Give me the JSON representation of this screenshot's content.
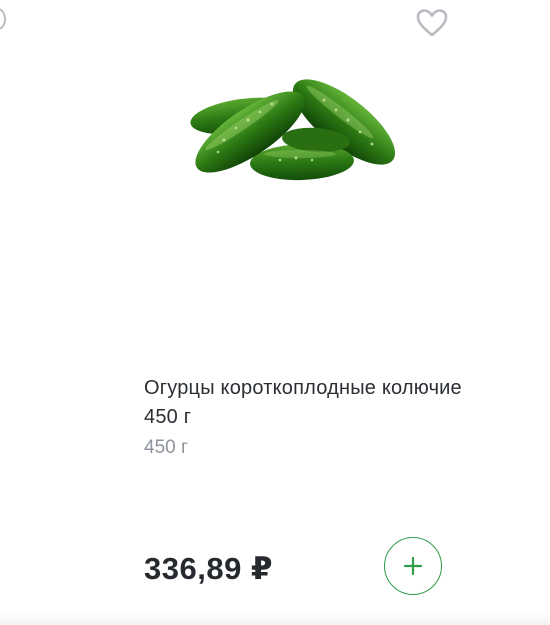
{
  "product": {
    "title": "Огурцы короткоплодные колючие 450 г",
    "weight": "450 г",
    "price": "336,89 ₽",
    "image_icon": "cucumbers-image"
  },
  "actions": {
    "favorite_icon": "heart-icon",
    "add_icon": "plus-icon"
  },
  "colors": {
    "accent_green": "#2e9e4a",
    "title_text": "#2b2f33",
    "muted_text": "#8e949b",
    "price_text": "#262a2e",
    "icon_gray": "#b8bcc2"
  }
}
